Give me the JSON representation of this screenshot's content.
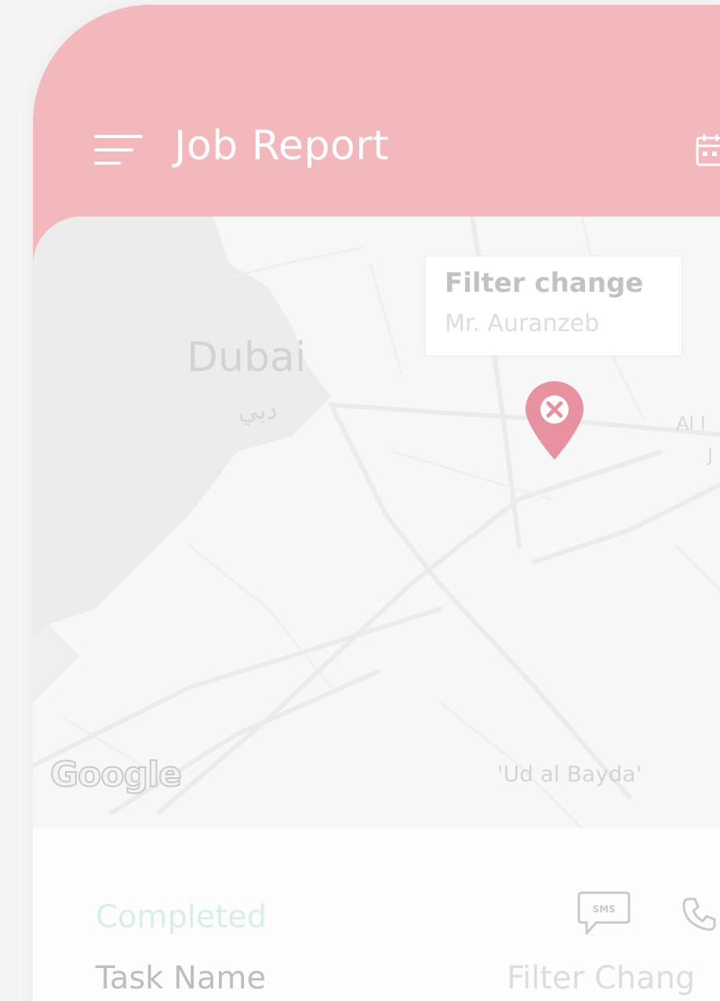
{
  "header": {
    "title": "Job Report",
    "background_color": "#f2b8bc",
    "menu_icon": "hamburger-menu-icon",
    "calendar_icon": "calendar-icon"
  },
  "map": {
    "city_label": "Dubai",
    "city_label_arabic": "دبي",
    "callout": {
      "title": "Filter change",
      "subtitle": "Mr. Auranzeb"
    },
    "pin_icon": "map-pin-icon",
    "pin_color": "#e891a0",
    "place_right": "Al I",
    "place_right_2": "J",
    "place_bottom": "'Ud al Bayda'",
    "google_logo": "Google"
  },
  "task": {
    "status": "Completed",
    "status_color": "#d6efe9",
    "name_label": "Task Name",
    "name_value": "Filter Chang",
    "chat_icon": "sms-chat-icon",
    "chat_text": "SMS",
    "call_icon": "phone-call-icon"
  }
}
